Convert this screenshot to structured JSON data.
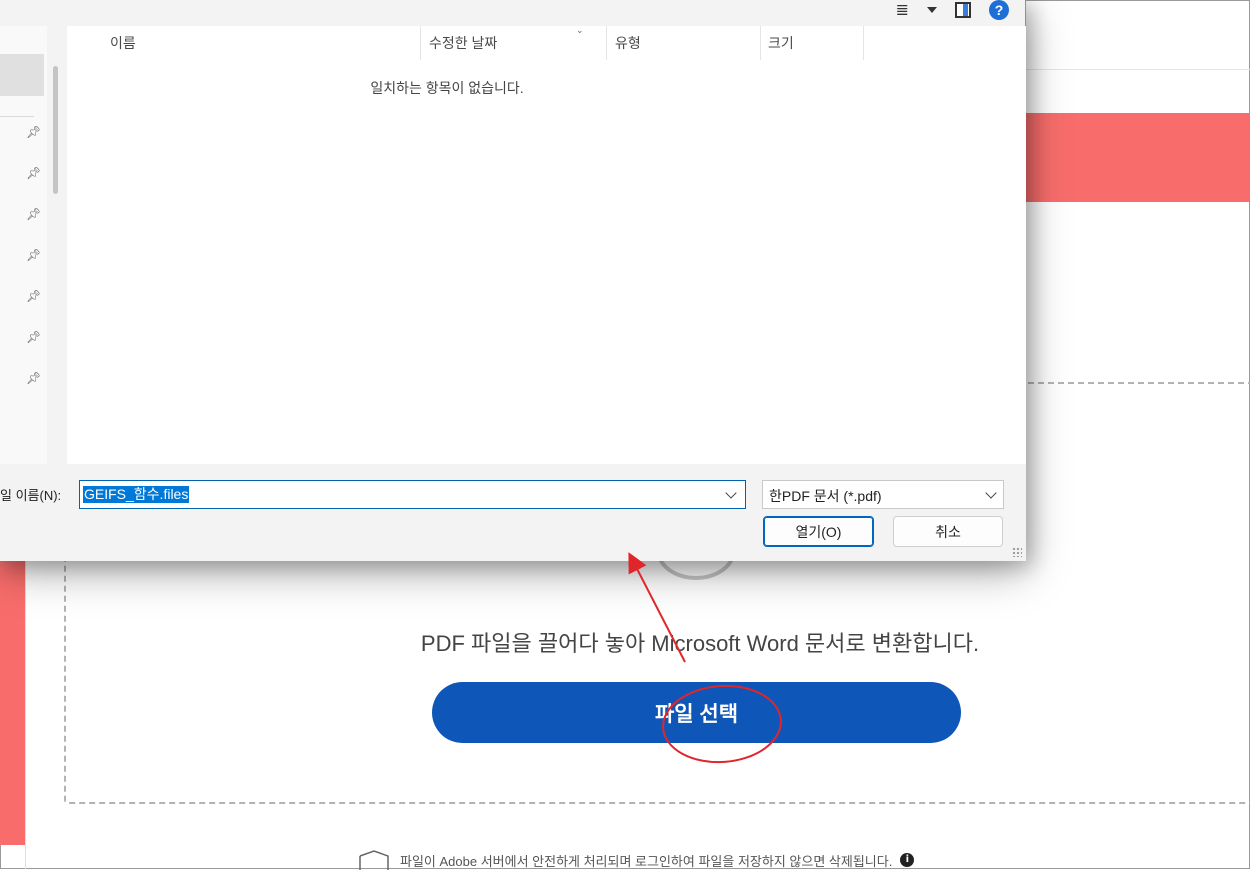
{
  "dialog": {
    "columns": {
      "name": "이름",
      "modified": "수정한 날짜",
      "type": "유형",
      "size": "크기"
    },
    "empty_message": "일치하는 항목이 없습니다.",
    "filename_label": "일 이름(N):",
    "filename_value": "GEIFS_함수.files",
    "filetype_value": "한PDF 문서 (*.pdf)",
    "open_button": "열기(O)",
    "cancel_button": "취소",
    "help_glyph": "?"
  },
  "page": {
    "drop_text": "PDF 파일을 끌어다 놓아 Microsoft Word 문서로 변환합니다.",
    "select_button": "파일 선택",
    "footer_note": "파일이 Adobe 서버에서 안전하게 처리되며 로그인하여 파일을 저장하지 않으면 삭제됩니다.",
    "info_glyph": "i"
  },
  "colors": {
    "brand_red": "#f86d6b",
    "button_blue": "#0e56b7",
    "annotation_red": "#e0262b"
  }
}
